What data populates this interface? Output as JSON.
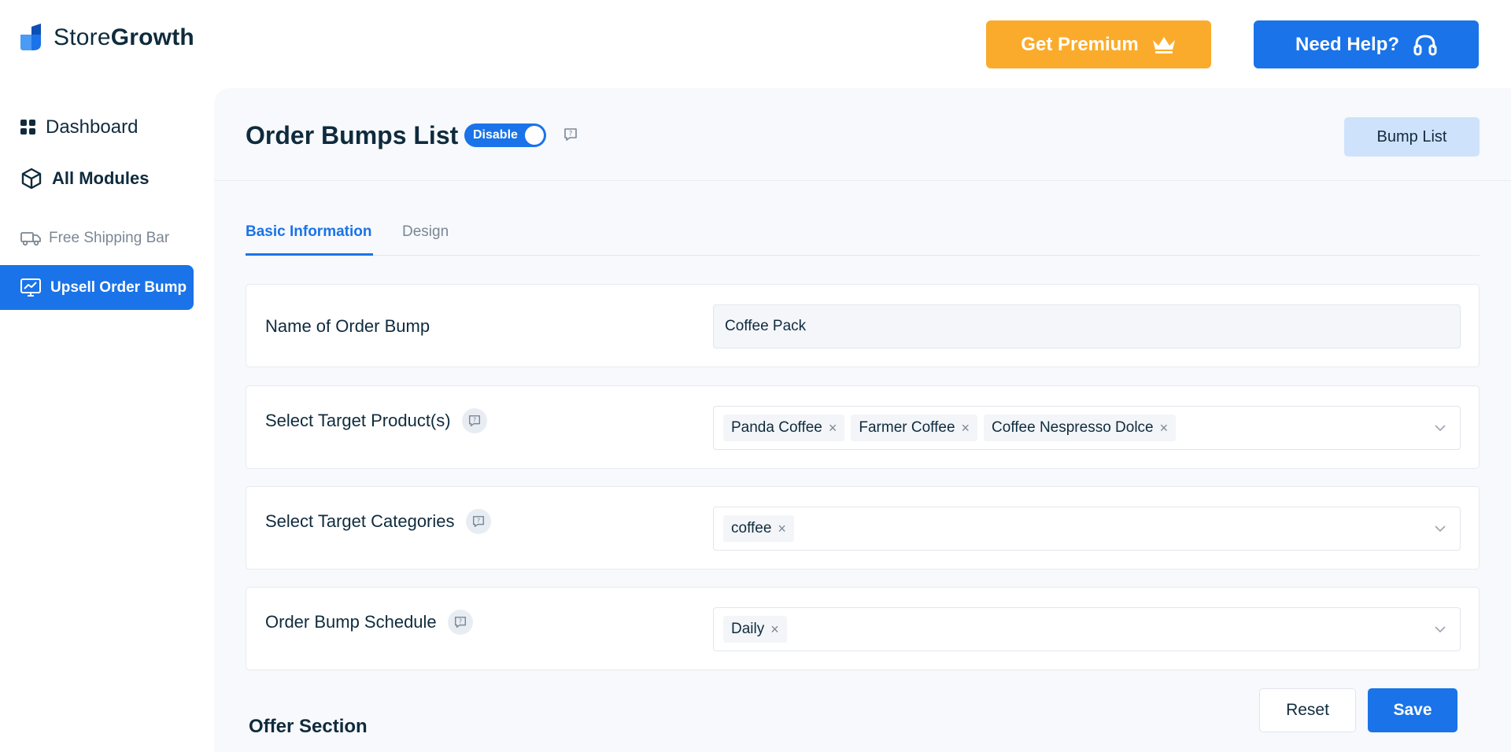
{
  "brand": {
    "name_part1": "Store",
    "name_part2": "Growth"
  },
  "header": {
    "premium_label": "Get Premium",
    "help_label": "Need Help?",
    "colors": {
      "premium": "#fbab2b",
      "primary": "#1a73e8"
    }
  },
  "sidebar": {
    "items": [
      {
        "label": "Dashboard",
        "icon": "grid-icon"
      },
      {
        "label": "All Modules",
        "icon": "cube-icon"
      },
      {
        "label": "Free Shipping Bar",
        "icon": "truck-icon"
      },
      {
        "label": "Upsell Order Bump",
        "icon": "chart-monitor-icon",
        "active": true
      }
    ]
  },
  "page": {
    "title": "Order Bumps List",
    "toggle_label": "Disable",
    "bump_list_label": "Bump List"
  },
  "tabs": [
    {
      "label": "Basic Information",
      "active": true
    },
    {
      "label": "Design",
      "active": false
    }
  ],
  "form": {
    "name": {
      "label": "Name of Order Bump",
      "value": "Coffee Pack"
    },
    "products": {
      "label": "Select Target Product(s)",
      "chips": [
        "Panda Coffee",
        "Farmer Coffee",
        "Coffee Nespresso Dolce"
      ]
    },
    "categories": {
      "label": "Select Target Categories",
      "chips": [
        "coffee"
      ]
    },
    "schedule": {
      "label": "Order Bump Schedule",
      "chips": [
        "Daily"
      ]
    }
  },
  "offer": {
    "title": "Offer Section"
  },
  "actions": {
    "reset_label": "Reset",
    "save_label": "Save"
  }
}
